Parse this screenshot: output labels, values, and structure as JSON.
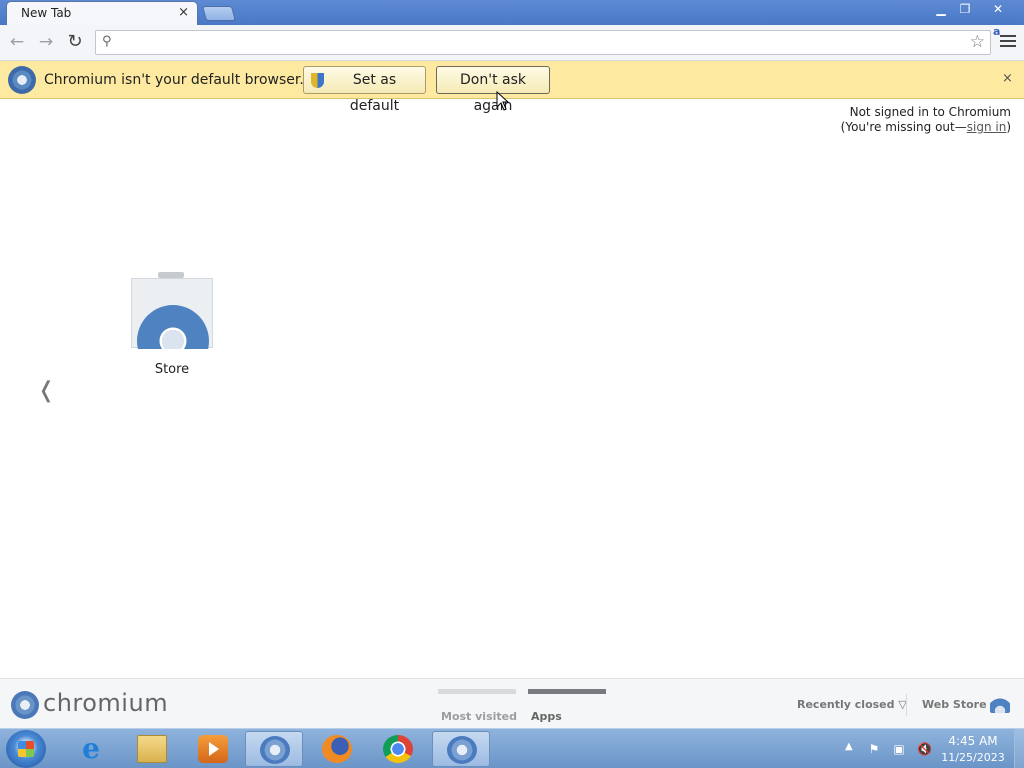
{
  "window": {
    "tab_title": "New Tab",
    "tab_close": "×",
    "minimize": "▁",
    "maximize": "❐",
    "close": "✕"
  },
  "toolbar": {
    "back": "←",
    "forward": "→",
    "reload": "↻",
    "omnibox_value": "",
    "omnibox_placeholder": "",
    "star": "☆",
    "extension_letter": "a"
  },
  "infobar": {
    "message": "Chromium isn't your default browser.",
    "set_default_label": "Set as default",
    "dont_ask_label": "Don't ask again",
    "close": "×"
  },
  "signin": {
    "line1": "Not signed in to Chromium",
    "line2_prefix": "(You're missing out—",
    "link": "sign in",
    "line2_suffix": ")"
  },
  "apps": {
    "prev_page": "❬",
    "items": [
      {
        "label": "Store"
      }
    ]
  },
  "footer": {
    "brand": "chromium",
    "tabs": [
      {
        "label": "Most visited",
        "selected": false
      },
      {
        "label": "Apps",
        "selected": true
      }
    ],
    "recently_closed": "Recently closed ▽",
    "web_store": "Web Store"
  },
  "taskbar": {
    "items": [
      "internet-explorer",
      "windows-explorer",
      "media-player",
      "chromium",
      "firefox",
      "chrome",
      "chromium"
    ],
    "tray_arrow": "▲",
    "tray_flag": "⚑",
    "tray_network": "▣",
    "tray_volume": "🔇",
    "time": "4:45 AM",
    "date": "11/25/2023"
  },
  "colors": {
    "titlebar": "#4a78c6",
    "infobar": "#fdeaa0",
    "accent": "#4f82c0"
  }
}
